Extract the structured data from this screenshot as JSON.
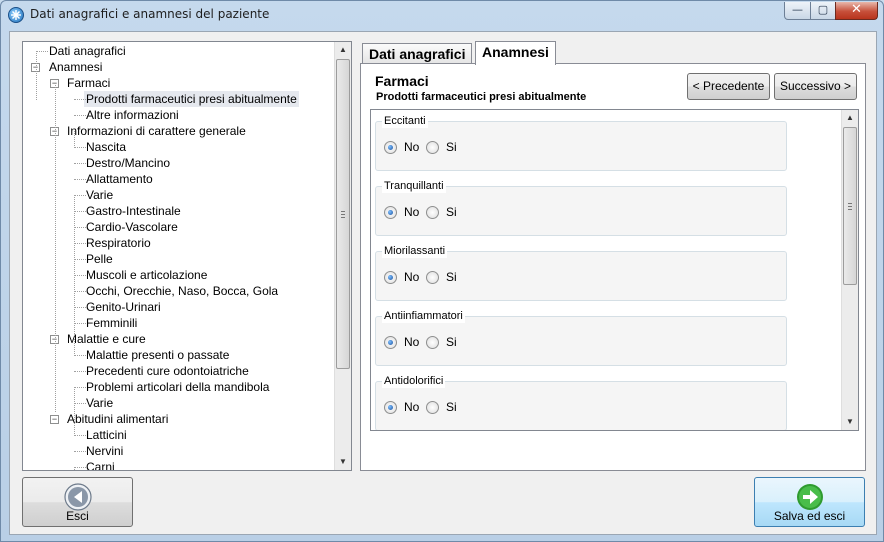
{
  "window": {
    "title": "Dati anagrafici e anamnesi del paziente"
  },
  "titlebar_buttons": {
    "minimize": "—",
    "maximize": "▢",
    "close": "✕"
  },
  "tree": {
    "items": [
      {
        "label": "Dati anagrafici",
        "level": 0
      },
      {
        "label": "Anamnesi",
        "level": 0,
        "expanded": true
      },
      {
        "label": "Farmaci",
        "level": 1,
        "expanded": true
      },
      {
        "label": "Prodotti farmaceutici presi abitualmente",
        "level": 2,
        "selected": true
      },
      {
        "label": "Altre informazioni",
        "level": 2
      },
      {
        "label": "Informazioni di carattere generale",
        "level": 1,
        "expanded": true
      },
      {
        "label": "Nascita",
        "level": 2
      },
      {
        "label": "Destro/Mancino",
        "level": 2
      },
      {
        "label": "Allattamento",
        "level": 2
      },
      {
        "label": "Varie",
        "level": 2
      },
      {
        "label": "Gastro-Intestinale",
        "level": 2
      },
      {
        "label": "Cardio-Vascolare",
        "level": 2
      },
      {
        "label": "Respiratorio",
        "level": 2
      },
      {
        "label": "Pelle",
        "level": 2
      },
      {
        "label": "Muscoli e articolazione",
        "level": 2
      },
      {
        "label": "Occhi, Orecchie, Naso, Bocca, Gola",
        "level": 2
      },
      {
        "label": "Genito-Urinari",
        "level": 2
      },
      {
        "label": "Femminili",
        "level": 2
      },
      {
        "label": "Malattie e cure",
        "level": 1,
        "expanded": true
      },
      {
        "label": "Malattie presenti o passate",
        "level": 2
      },
      {
        "label": "Precedenti cure odontoiatriche",
        "level": 2
      },
      {
        "label": "Problemi articolari della mandibola",
        "level": 2
      },
      {
        "label": "Varie",
        "level": 2
      },
      {
        "label": "Abitudini alimentari",
        "level": 1,
        "expanded": true
      },
      {
        "label": "Latticini",
        "level": 2
      },
      {
        "label": "Nervini",
        "level": 2
      },
      {
        "label": "Carni",
        "level": 2
      }
    ]
  },
  "tabs": [
    {
      "label": "Dati anagrafici",
      "active": false
    },
    {
      "label": "Anamnesi",
      "active": true
    }
  ],
  "section": {
    "title": "Farmaci",
    "subtitle": "Prodotti farmaceutici presi abitualmente",
    "prev_label": "< Precedente",
    "next_label": "Successivo >"
  },
  "groups": [
    {
      "title": "Eccitanti",
      "no_label": "No",
      "si_label": "Si",
      "selected": "No"
    },
    {
      "title": "Tranquillanti",
      "no_label": "No",
      "si_label": "Si",
      "selected": "No"
    },
    {
      "title": "Miorilassanti",
      "no_label": "No",
      "si_label": "Si",
      "selected": "No"
    },
    {
      "title": "Antiinfiammatori",
      "no_label": "No",
      "si_label": "Si",
      "selected": "No"
    },
    {
      "title": "Antidolorifici",
      "no_label": "No",
      "si_label": "Si",
      "selected": "No"
    }
  ],
  "footer": {
    "exit_label": "Esci",
    "save_label": "Salva ed esci"
  },
  "colors": {
    "back_icon": "#6d7a8a",
    "save_icon": "#39a83a"
  }
}
